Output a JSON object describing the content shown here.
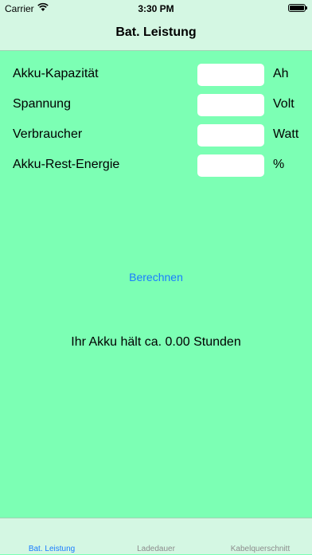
{
  "status_bar": {
    "carrier": "Carrier",
    "time": "3:30 PM",
    "wifi_icon": "wifi-icon",
    "battery_icon": "battery-icon"
  },
  "nav": {
    "title": "Bat. Leistung"
  },
  "form": {
    "fields": [
      {
        "label": "Akku-Kapazität",
        "value": "",
        "unit": "Ah"
      },
      {
        "label": "Spannung",
        "value": "",
        "unit": "Volt"
      },
      {
        "label": "Verbraucher",
        "value": "",
        "unit": "Watt"
      },
      {
        "label": "Akku-Rest-Energie",
        "value": "",
        "unit": "%"
      }
    ],
    "calculate_label": "Berechnen",
    "result_text": "Ihr Akku hält ca. 0.00 Stunden"
  },
  "tabs": [
    {
      "label": "Bat. Leistung",
      "active": true
    },
    {
      "label": "Ladedauer",
      "active": false
    },
    {
      "label": "Kabelquerschnitt",
      "active": false
    }
  ],
  "colors": {
    "background": "#7cffb4",
    "bar": "#d4f7e3",
    "accent": "#1a7cff",
    "inactive_tab": "#8c8c8c"
  }
}
